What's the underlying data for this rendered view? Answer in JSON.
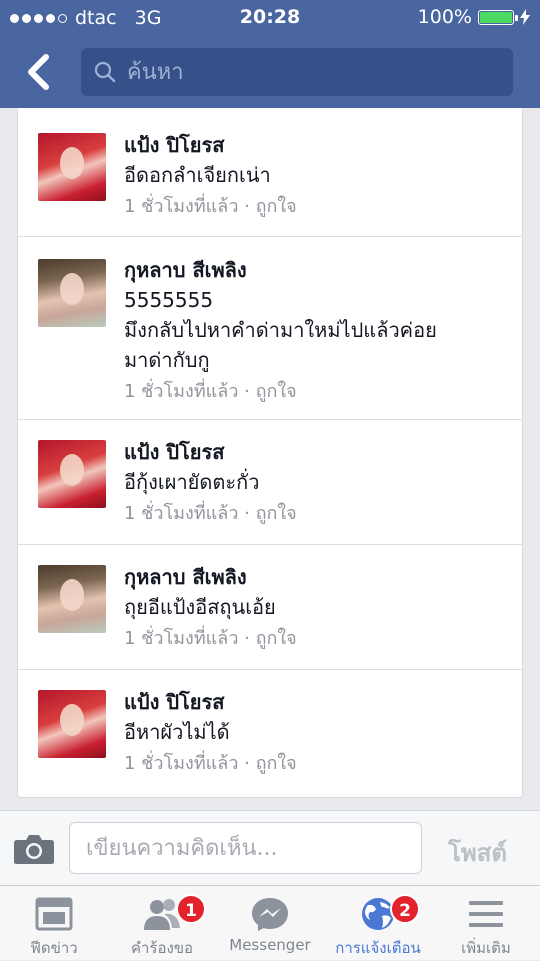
{
  "status_bar": {
    "carrier": "dtac",
    "network": "3G",
    "time": "20:28",
    "battery": "100%"
  },
  "search": {
    "placeholder": "ค้นหา"
  },
  "comments": [
    {
      "name": "แป้ง ปิโยรส",
      "text": "อีดอกลำเจียกเน่า",
      "meta": "1 ชั่วโมงที่แล้ว · ถูกใจ"
    },
    {
      "name": "กุหลาบ สีเพลิง",
      "text": "5555555",
      "text2": "มึงกลับไปหาคำด่ามาใหม่ไปแล้วค่อย",
      "text3": "มาด่ากับกู",
      "meta": "1 ชั่วโมงที่แล้ว · ถูกใจ"
    },
    {
      "name": "แป้ง ปิโยรส",
      "text": "อีกุ้งเผายัดตะกั่ว",
      "meta": "1 ชั่วโมงที่แล้ว · ถูกใจ"
    },
    {
      "name": "กุหลาบ สีเพลิง",
      "text": "ถุยอีแป้งอีสถุนเอ้ย",
      "meta": "1 ชั่วโมงที่แล้ว · ถูกใจ"
    },
    {
      "name": "แป้ง ปิโยรส",
      "text": "อีหาผัวไม่ได้",
      "meta": "1 ชั่วโมงที่แล้ว · ถูกใจ"
    }
  ],
  "composer": {
    "placeholder": "เขียนความคิดเห็น...",
    "post_label": "โพสต์"
  },
  "tabs": [
    {
      "label": "ฟีดข่าว"
    },
    {
      "label": "คำร้องขอ",
      "badge": "1"
    },
    {
      "label": "Messenger"
    },
    {
      "label": "การแจ้งเตือน",
      "badge": "2"
    },
    {
      "label": "เพิ่มเติม"
    }
  ],
  "colors": {
    "header": "#4a66a0",
    "search_bg": "#36508a",
    "badge": "#e4222b",
    "active_tab": "#4a78d4",
    "battery": "#4cd964"
  }
}
